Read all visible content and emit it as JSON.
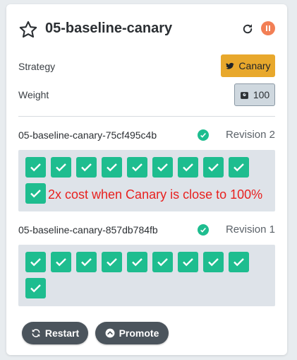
{
  "header": {
    "title": "05-baseline-canary"
  },
  "strategy": {
    "label": "Strategy",
    "value": "Canary"
  },
  "weight": {
    "label": "Weight",
    "value": "100"
  },
  "revisions": [
    {
      "name": "05-baseline-canary-75cf495c4b",
      "revision_label": "Revision 2",
      "pod_count": 10,
      "pod_status": "healthy",
      "note": "2x cost when Canary is close to 100%"
    },
    {
      "name": "05-baseline-canary-857db784fb",
      "revision_label": "Revision 1",
      "pod_count": 10,
      "pod_status": "healthy"
    }
  ],
  "actions": {
    "restart_label": "Restart",
    "promote_label": "Promote"
  },
  "colors": {
    "accent_canary": "#e8a82c",
    "pod_healthy": "#1ebd8f",
    "pause": "#f27f55",
    "note_red": "#e8211f",
    "button_dark": "#4b545c"
  },
  "icons": [
    "star-icon",
    "refresh-icon",
    "pause-icon",
    "bird-icon",
    "weight-icon",
    "check-circle-icon",
    "sync-icon",
    "arrow-circle-up-icon"
  ]
}
